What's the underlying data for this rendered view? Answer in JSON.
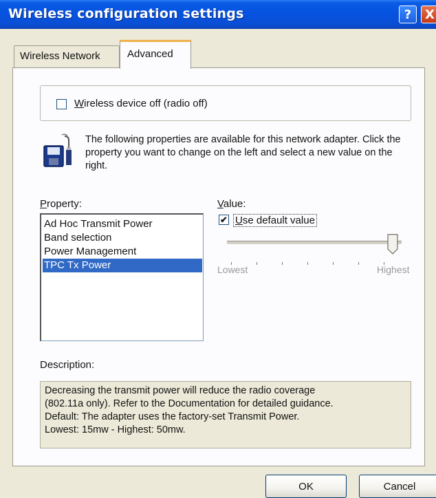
{
  "window": {
    "title": "Wireless configuration settings",
    "help_label": "?",
    "close_label": "X"
  },
  "tabs": [
    {
      "label": "Wireless Network",
      "active": false
    },
    {
      "label": "Advanced",
      "active": true
    }
  ],
  "radio_off": {
    "label_underlined": "W",
    "label_rest": "ireless device off (radio off)",
    "checked": false
  },
  "info": {
    "icon": "network-adapter-icon",
    "text": "The following properties are available for this network adapter. Click the property you want to change on the left and select a new value on the right."
  },
  "property": {
    "label_underlined": "P",
    "label_rest": "roperty:",
    "items": [
      "Ad Hoc Transmit Power",
      "Band selection",
      "Power Management",
      "TPC Tx Power"
    ],
    "selected_index": 3
  },
  "value": {
    "label_underlined": "V",
    "label_rest": "alue:",
    "use_default_underlined": "U",
    "use_default_rest": "se default value",
    "use_default_checked": true,
    "check_mark": "✔",
    "slider_level": 1.0,
    "lowest_label": "Lowest",
    "highest_label": "Highest"
  },
  "description": {
    "label": "Description:",
    "lines": [
      "Decreasing the transmit power will reduce the radio coverage",
      "(802.11a only). Refer to the Documentation for detailed guidance.",
      "Default: The adapter uses the factory-set Transmit Power.",
      "Lowest: 15mw  - Highest: 50mw."
    ]
  },
  "buttons": {
    "ok": "OK",
    "cancel": "Cancel"
  },
  "colors": {
    "titlebar": "#0553e0",
    "selection": "#3169c6",
    "face": "#ECE9D8"
  }
}
